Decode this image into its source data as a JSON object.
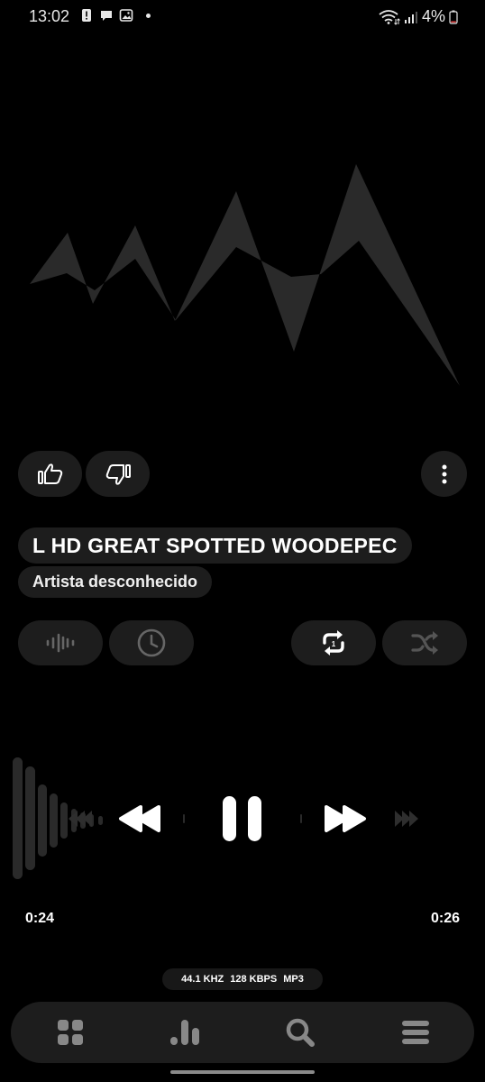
{
  "status_bar": {
    "time": "13:02",
    "battery": "4%",
    "notification_icons": [
      "alert-icon",
      "chat-icon",
      "image-icon"
    ]
  },
  "track": {
    "title": "L HD GREAT SPOTTED WOODEPEC",
    "artist": "Artista desconhecido"
  },
  "playback": {
    "elapsed": "0:24",
    "remaining": "0:26",
    "state": "playing"
  },
  "format": {
    "sample_rate": "44.1 KHZ",
    "bitrate": "128 KBPS",
    "codec": "MP3"
  },
  "actions": {
    "like_icon": "thumbs-up-icon",
    "dislike_icon": "thumbs-down-icon",
    "more_icon": "more-vertical-icon",
    "visualizer_icon": "waveform-icon",
    "sleep_timer_icon": "clock-icon",
    "repeat_icon": "repeat-one-icon",
    "shuffle_icon": "shuffle-icon"
  },
  "bottom_nav": [
    "grid-icon",
    "bars-icon",
    "search-icon",
    "menu-icon"
  ],
  "colors": {
    "background": "#000000",
    "pill": "#1d1d1d",
    "artwork": "#2a2a2a",
    "text": "#ffffff"
  }
}
